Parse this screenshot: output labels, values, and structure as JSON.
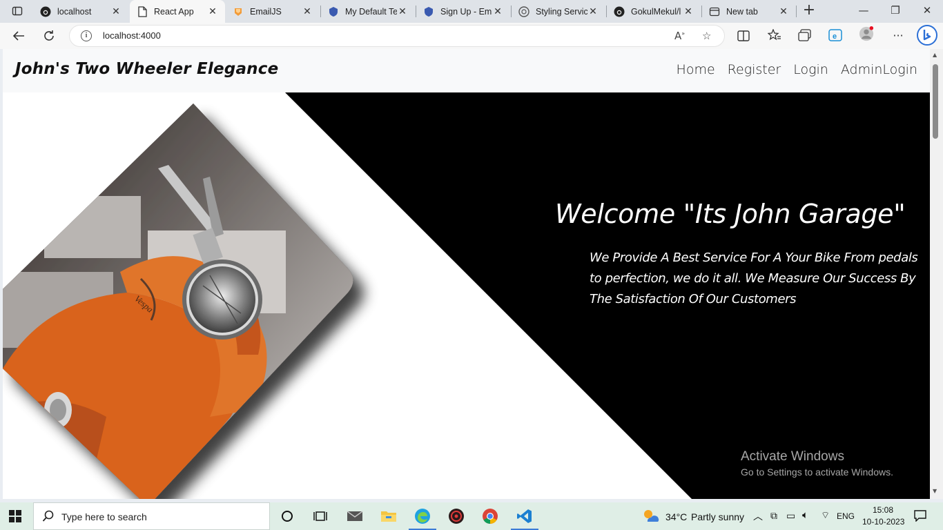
{
  "browser": {
    "tabs": [
      {
        "title": "localhost",
        "icon": "github-icon",
        "active": false
      },
      {
        "title": "React App",
        "icon": "page-icon",
        "active": true
      },
      {
        "title": "EmailJS",
        "icon": "emailjs-icon",
        "active": false
      },
      {
        "title": "My Default Te",
        "icon": "shield-icon",
        "active": false
      },
      {
        "title": "Sign Up - Ema",
        "icon": "shield-icon",
        "active": false
      },
      {
        "title": "Styling Servic",
        "icon": "chatgpt-icon",
        "active": false
      },
      {
        "title": "GokulMekul/l",
        "icon": "github-icon",
        "active": false
      },
      {
        "title": "New tab",
        "icon": "newtab-icon",
        "active": false
      }
    ],
    "url": "localhost:4000"
  },
  "site": {
    "brand": "John's Two Wheeler Elegance",
    "nav": [
      "Home",
      "Register",
      "Login",
      "AdminLogin"
    ],
    "hero": {
      "title": "Welcome \"Its John Garage\"",
      "tagline": "We Provide A Best Service For A Your Bike From pedals to perfection, we do it all. We Measure Our Success By The Satisfaction Of Our Customers"
    }
  },
  "watermark": {
    "line1": "Activate Windows",
    "line2": "Go to Settings to activate Windows."
  },
  "taskbar": {
    "search_placeholder": "Type here to search",
    "weather_temp": "34°C",
    "weather_text": "Partly sunny",
    "lang": "ENG",
    "time": "15:08",
    "date": "10-10-2023"
  },
  "colors": {
    "hero_black": "#000000",
    "scooter_orange": "#d9631a",
    "header_bg": "#f8f9fa",
    "taskbar_bg": "#dfeee6"
  }
}
